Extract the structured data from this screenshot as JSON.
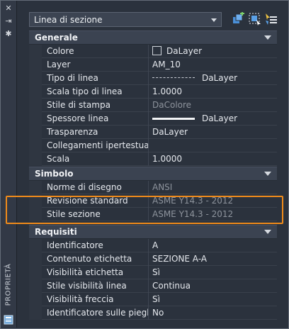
{
  "sidebar": {
    "title": "PROPRIETÀ",
    "close_glyph": "✕",
    "autohide_glyph": "⇥",
    "settings_glyph": "✱"
  },
  "toolbar": {
    "selection_value": "Linea di sezione",
    "buttons": [
      "toggle-pickadd-icon",
      "select-objects-icon",
      "quick-select-icon"
    ]
  },
  "categories": {
    "generale": {
      "label": "Generale",
      "rows": [
        {
          "name": "Colore",
          "value": "DaLayer"
        },
        {
          "name": "Layer",
          "value": "AM_10"
        },
        {
          "name": "Tipo di linea",
          "value": "DaLayer"
        },
        {
          "name": "Scala tipo di linea",
          "value": "1.0000"
        },
        {
          "name": "Stile di stampa",
          "value": "DaColore"
        },
        {
          "name": "Spessore linea",
          "value": "DaLayer"
        },
        {
          "name": "Trasparenza",
          "value": "DaLayer"
        },
        {
          "name": "Collegamenti ipertestuali",
          "value": ""
        },
        {
          "name": "Scala",
          "value": "1.0000"
        }
      ]
    },
    "simbolo": {
      "label": "Simbolo",
      "rows": [
        {
          "name": "Norme di disegno",
          "value": "ANSI"
        },
        {
          "name": "Revisione standard",
          "value": "ASME Y14.3 - 2012"
        },
        {
          "name": "Stile sezione",
          "value": "ASME Y14.3 - 2012"
        }
      ]
    },
    "requisiti": {
      "label": "Requisiti",
      "rows": [
        {
          "name": "Identificatore",
          "value": "A"
        },
        {
          "name": "Contenuto etichetta",
          "value": "SEZIONE A-A"
        },
        {
          "name": "Visibilità etichetta",
          "value": "Sì"
        },
        {
          "name": "Stile visibilità linea",
          "value": "Continua"
        },
        {
          "name": "Visibilità freccia",
          "value": "Sì"
        },
        {
          "name": "Identificatore sulle pieghe",
          "value": "No"
        }
      ]
    }
  },
  "colors": {
    "highlight": "#f08b1a",
    "panel_bg": "#2b323d",
    "category_bg": "#3b4351"
  }
}
